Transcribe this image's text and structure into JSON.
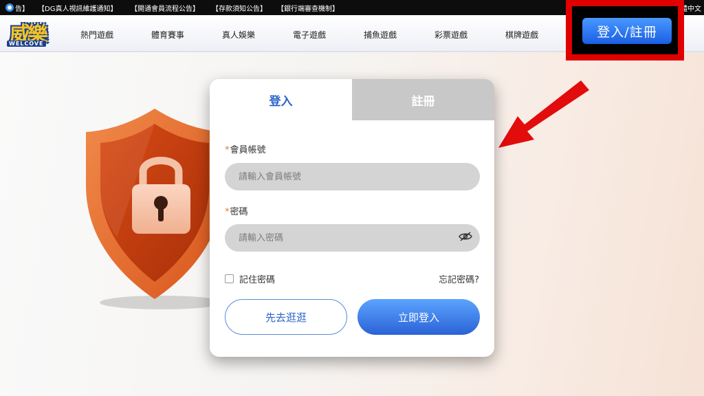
{
  "topbar": {
    "speaker_icon": "speaker-icon",
    "announcements": [
      "告】",
      "【DG真人視訊維護通知】",
      "【開通會員流程公告】",
      "【存款須知公告】",
      "【銀行端審查機制】"
    ],
    "language": "體中文"
  },
  "nav": {
    "logo_text": "威樂",
    "logo_word": "WELCOVE",
    "items": [
      "熱門遊戲",
      "體育賽事",
      "真人娛樂",
      "電子遊戲",
      "捕魚遊戲",
      "彩票遊戲",
      "棋牌遊戲"
    ],
    "login_register_label": "登入/註冊"
  },
  "card": {
    "tabs": {
      "login": "登入",
      "register": "註冊"
    },
    "account": {
      "required_mark": "*",
      "label": "會員帳號",
      "placeholder": "請輸入會員帳號"
    },
    "password": {
      "required_mark": "*",
      "label": "密碼",
      "placeholder": "請輸入密碼"
    },
    "remember_label": "記住密碼",
    "forgot_label": "忘記密碼?",
    "browse_button": "先去逛逛",
    "login_button": "立即登入"
  },
  "colors": {
    "accent_blue": "#2a64c8",
    "highlight_red": "#e00000",
    "shield_orange": "#e06a2a"
  }
}
